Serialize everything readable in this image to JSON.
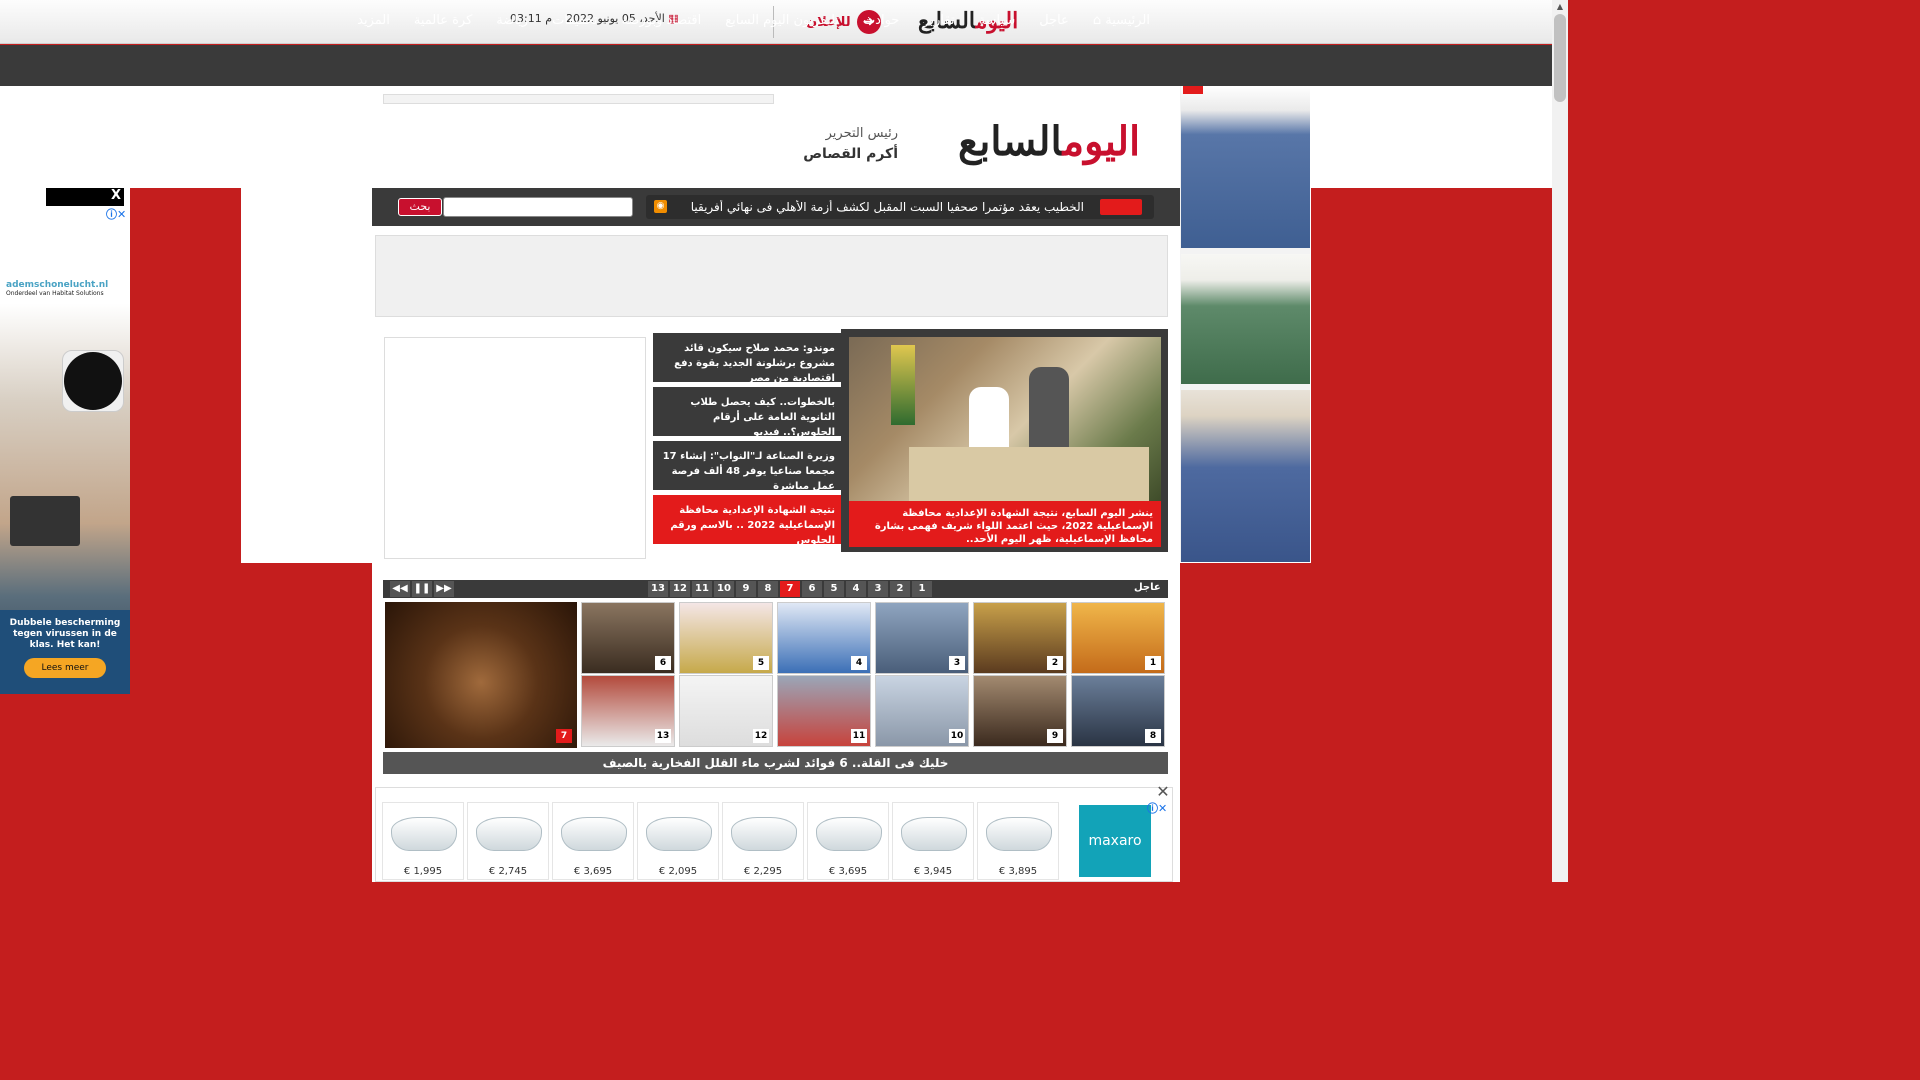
{
  "header": {
    "logo_red": "اليوم",
    "logo_black": "السابع",
    "advertise_label": "للإعلان",
    "date": "الأحد، 05 يونيو 2022",
    "time": "03:11 م"
  },
  "nav": {
    "items": [
      "الرئيسية",
      "عاجل",
      "سياسة",
      "تقارير",
      "حوادث",
      "تليفزيون اليوم السابع",
      "اقتصاد وبورصة",
      "تحقيقات",
      "رياضة",
      "كرة عالمية",
      "المزيد"
    ]
  },
  "masthead": {
    "editor_title": "رئيس التحرير",
    "editor_name": "أكرم القصاص"
  },
  "ticker": {
    "text": "الخطيب يعقد مؤتمرا صحفيا السبت المقبل لكشف أزمة الأهلي فى نهائي أفريقيا",
    "search_button": "بحث"
  },
  "featured": {
    "caption": "ينشر اليوم السابع، نتيجة الشهادة الإعدادية محافظة الإسماعيلية 2022، حيث اعتمد اللواء شريف فهمى بشارة محافظ الإسماعيلية، ظهر اليوم الأحد.."
  },
  "side_news": [
    {
      "text": "موندو: محمد صلاح سيكون قائد مشروع برشلونة الجديد بقوة دفع اقتصادية من مصر"
    },
    {
      "text": "بالخطوات.. كيف يحصل طلاب الثانوية العامة على أرقام الجلوس؟.. فيديو"
    },
    {
      "text": "وزيرة الصناعة لـ\"النواب\": إنشاء 17 مجمعا صناعيا يوفر 48 ألف فرصة عمل مباشرة"
    },
    {
      "text": "نتيجة الشهادة الإعدادية محافظة الإسماعيلية 2022 .. بالاسم ورقم الجلوس"
    }
  ],
  "urgent": {
    "label": "عاجل",
    "pages": [
      "1",
      "2",
      "3",
      "4",
      "5",
      "6",
      "7",
      "8",
      "9",
      "10",
      "11",
      "12",
      "13"
    ],
    "active_page": "7",
    "caption": "خليك فى القلة.. 6 فوائد لشرب ماء القلل الفخارية بالصيف"
  },
  "thumbs": [
    "1",
    "2",
    "3",
    "4",
    "5",
    "6",
    "7",
    "8",
    "9",
    "10",
    "11",
    "12",
    "13"
  ],
  "bottom_ad": {
    "prices": [
      "€ 1,995",
      "€ 2,745",
      "€ 3,695",
      "€ 2,095",
      "€ 2,295",
      "€ 3,695",
      "€ 3,945",
      "€ 3,895"
    ],
    "brand": "maxaro"
  },
  "left_ad": {
    "brand": "ademschonelucht.nl",
    "brand_sub": "Onderdeel van Habitat Solutions",
    "headline": "Dubbele bescherming tegen virussen in de klas. Het kan!",
    "cta": "Lees meer",
    "close": "X"
  },
  "colors": {
    "brand_red": "#c8102e",
    "nav_dark": "#3a3a3a",
    "accent_red": "#e31b1b"
  }
}
